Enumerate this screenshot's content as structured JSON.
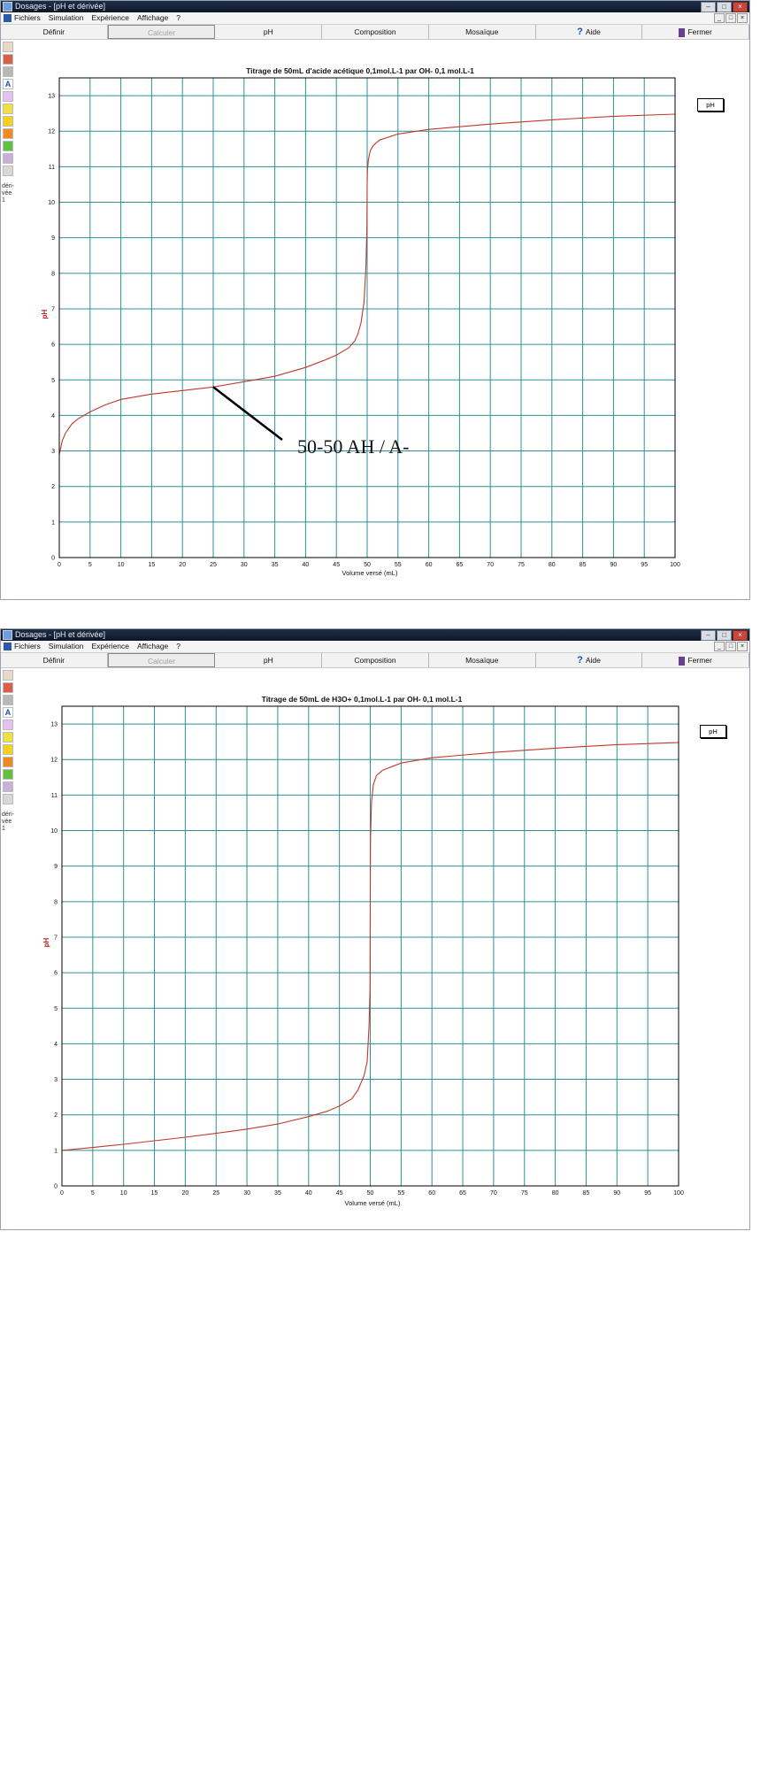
{
  "windows": [
    {
      "title": "Dosages - [pH et dérivée]",
      "menu": [
        "Fichiers",
        "Simulation",
        "Expérience",
        "Affichage",
        "?"
      ],
      "toolbar": [
        "Définir",
        "Calculer",
        "pH",
        "Composition",
        "Mosaïque",
        "Aide",
        "Fermer"
      ],
      "sidebar_text": [
        "déri-",
        "vée",
        "1"
      ],
      "legend": "pH",
      "chart_data": {
        "type": "line",
        "title": "Titrage de 50mL d'acide acétique 0,1mol.L-1  par OH-  0,1 mol.L-1",
        "xlabel": "Volume versé (mL)",
        "ylabel": "pH",
        "xlim": [
          0,
          100
        ],
        "ylim": [
          0,
          13.5
        ],
        "xticks": [
          0,
          5,
          10,
          15,
          20,
          25,
          30,
          35,
          40,
          45,
          50,
          55,
          60,
          65,
          70,
          75,
          80,
          85,
          90,
          95,
          100
        ],
        "yticks": [
          0,
          1,
          2,
          3,
          4,
          5,
          6,
          7,
          8,
          9,
          10,
          11,
          12,
          13
        ],
        "grid": true,
        "series": [
          {
            "name": "pH",
            "color": "#c0392b",
            "x": [
              0,
              0.5,
              1,
              2,
              3,
              5,
              7.5,
              10,
              15,
              20,
              25,
              30,
              35,
              40,
              43,
              45,
              47,
              48,
              48.5,
              49,
              49.5,
              49.8,
              49.95,
              50,
              50.05,
              50.2,
              50.5,
              51,
              52,
              55,
              60,
              70,
              80,
              90,
              100
            ],
            "y": [
              2.9,
              3.3,
              3.5,
              3.75,
              3.9,
              4.1,
              4.3,
              4.45,
              4.6,
              4.7,
              4.8,
              4.95,
              5.1,
              5.35,
              5.55,
              5.7,
              5.9,
              6.1,
              6.3,
              6.6,
              7.2,
              8.2,
              9.3,
              10.5,
              10.9,
              11.2,
              11.45,
              11.6,
              11.75,
              11.92,
              12.05,
              12.2,
              12.32,
              12.42,
              12.48
            ]
          }
        ],
        "annotation": {
          "text": "50-50 AH / A-",
          "point": [
            25,
            4.8
          ]
        }
      }
    },
    {
      "title": "Dosages - [pH et dérivée]",
      "menu": [
        "Fichiers",
        "Simulation",
        "Expérience",
        "Affichage",
        "?"
      ],
      "toolbar": [
        "Définir",
        "Calculer",
        "pH",
        "Composition",
        "Mosaïque",
        "Aide",
        "Fermer"
      ],
      "sidebar_text": [
        "déri-",
        "vée",
        "1"
      ],
      "legend": "pH",
      "chart_data": {
        "type": "line",
        "title": "Titrage de 50mL de H3O+ 0,1mol.L-1  par OH-  0,1 mol.L-1",
        "xlabel": "Volume versé (mL)",
        "ylabel": "pH",
        "xlim": [
          0,
          100
        ],
        "ylim": [
          0,
          13.5
        ],
        "xticks": [
          0,
          5,
          10,
          15,
          20,
          25,
          30,
          35,
          40,
          45,
          50,
          55,
          60,
          65,
          70,
          75,
          80,
          85,
          90,
          95,
          100
        ],
        "yticks": [
          0,
          1,
          2,
          3,
          4,
          5,
          6,
          7,
          8,
          9,
          10,
          11,
          12,
          13
        ],
        "grid": true,
        "series": [
          {
            "name": "pH",
            "color": "#c0392b",
            "x": [
              0,
              5,
              10,
              15,
              20,
              25,
              30,
              35,
              40,
              43,
              45,
              47,
              48,
              48.5,
              49,
              49.5,
              49.8,
              49.95,
              50,
              50.05,
              50.2,
              50.5,
              51,
              52,
              55,
              60,
              70,
              80,
              90,
              100
            ],
            "y": [
              1.0,
              1.08,
              1.17,
              1.27,
              1.37,
              1.48,
              1.6,
              1.74,
              1.95,
              2.1,
              2.25,
              2.45,
              2.7,
              2.9,
              3.1,
              3.5,
              4.5,
              5.5,
              8.5,
              9.8,
              10.8,
              11.3,
              11.55,
              11.7,
              11.9,
              12.05,
              12.2,
              12.32,
              12.42,
              12.48
            ]
          }
        ]
      }
    }
  ]
}
